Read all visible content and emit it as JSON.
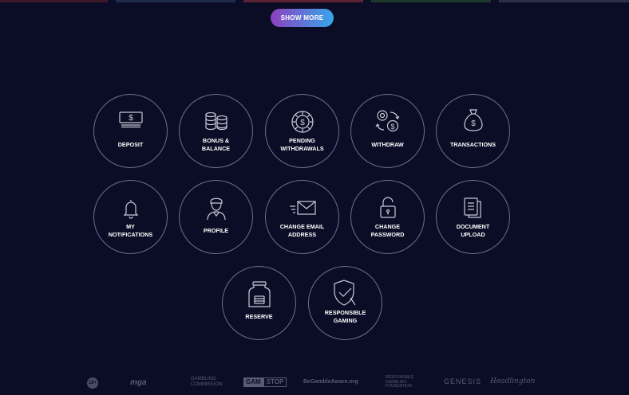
{
  "colors": {
    "background": "#0b0c25",
    "tile_border": "#6d6f89",
    "button_gradient_start": "#8e3fbf",
    "button_gradient_end": "#36a6ea",
    "icon_stroke": "#c9cad8",
    "footer_logo": "#5a5c73"
  },
  "top_strip_colors": [
    "#3c1a2a",
    "#1f2b4a",
    "#5a2130",
    "#1d3a2a",
    "#2a2f4a"
  ],
  "show_more": {
    "label": "SHOW MORE"
  },
  "tiles": [
    {
      "label": "DEPOSIT",
      "icon": "cash-icon"
    },
    {
      "label": "BONUS &\nBALANCE",
      "icon": "coin-stacks-icon"
    },
    {
      "label": "PENDING\nWITHDRAWALS",
      "icon": "chip-icon"
    },
    {
      "label": "WITHDRAW",
      "icon": "exchange-icon"
    },
    {
      "label": "TRANSACTIONS",
      "icon": "money-bag-icon"
    },
    {
      "label": "MY\nNOTIFICATIONS",
      "icon": "bell-icon"
    },
    {
      "label": "PROFILE",
      "icon": "avatar-icon"
    },
    {
      "label": "CHANGE EMAIL\nADDRESS",
      "icon": "envelope-icon"
    },
    {
      "label": "CHANGE\nPASSWORD",
      "icon": "padlock-icon"
    },
    {
      "label": "DOCUMENT\nUPLOAD",
      "icon": "documents-icon"
    },
    {
      "label": "RESERVE",
      "icon": "jar-icon"
    },
    {
      "label": "RESPONSIBLE\nGAMING",
      "icon": "shield-check-icon"
    }
  ],
  "footer": {
    "age": "18+",
    "mga": "mga",
    "gambling_commission": "GAMBLING\nCOMMISSION",
    "gamstop_a": "GAM",
    "gamstop_b": "STOP",
    "begambleaware": "BeGambleAware.org",
    "rgf": "RESPONSIBLE\nGAMBLING\nFOUNDATION",
    "genesis": "GENESIS",
    "signature": "Headlington"
  }
}
